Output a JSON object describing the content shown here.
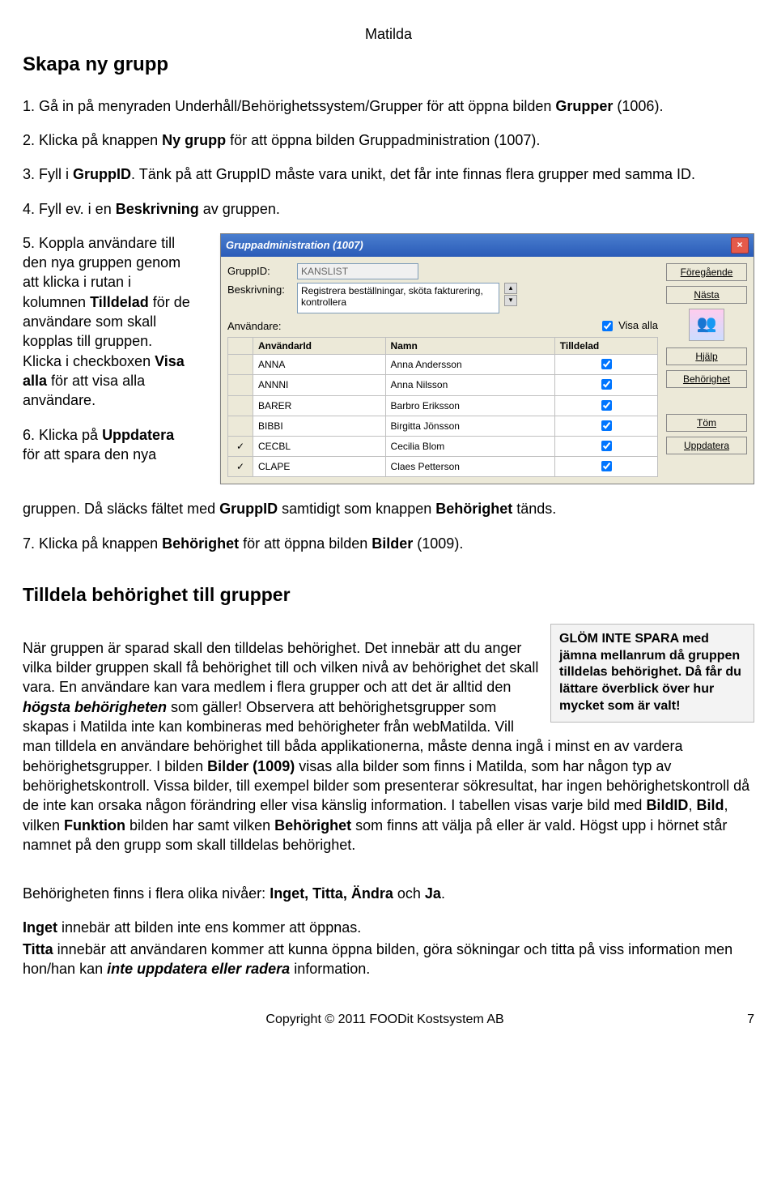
{
  "doc": {
    "header": "Matilda",
    "h1": "Skapa ny grupp",
    "step1_a": "1. Gå in på menyraden Underhåll/Behörighetssystem/Grupper för att öppna bilden ",
    "step1_b": "Grupper",
    "step1_c": " (1006).",
    "step2_a": "2. Klicka på knappen ",
    "step2_b": "Ny grupp",
    "step2_c": " för att öppna bilden Gruppadministration (1007).",
    "step3_a": "3. Fyll i ",
    "step3_b": "GruppID",
    "step3_c": ". Tänk på att GruppID måste vara unikt, det får inte finnas flera grupper med samma ID.",
    "step4_a": "4. Fyll ev. i en ",
    "step4_b": "Beskrivning",
    "step4_c": " av gruppen.",
    "step5_a": "5. Koppla användare till den nya gruppen genom att klicka i rutan i kolumnen ",
    "step5_b": "Tilldelad",
    "step5_c": " för de användare som skall kopplas till gruppen. Klicka i checkboxen ",
    "step5_d": "Visa alla",
    "step5_e": " för att visa alla användare.",
    "step6_a": "6. Klicka på ",
    "step6_b": "Uppdatera",
    "step6_c": " för att spara den nya",
    "step6_d": "gruppen. Då släcks fältet med ",
    "step6_e": "GruppID",
    "step6_f": " samtidigt som knappen ",
    "step6_g": "Behörighet",
    "step6_h": " tänds.",
    "step7_a": "7. Klicka på knappen ",
    "step7_b": "Behörighet",
    "step7_c": " för att öppna bilden ",
    "step7_d": "Bilder",
    "step7_e": " (1009).",
    "h2": "Tilldela behörighet till grupper",
    "tilldela_p1_a": "När gruppen är sparad skall den tilldelas behörighet. Det innebär att du anger vilka bilder gruppen skall få behörighet till och vilken nivå av behörighet det skall vara. En användare kan vara medlem i flera grupper och att det är alltid den ",
    "tilldela_p1_b": "högsta behörigheten",
    "tilldela_p1_c": " som gäller! Observera att behörighetsgrupper som skapas i Matilda inte kan kombineras med behörigheter från webMatilda. Vill man tilldela en användare behörighet till båda applikationerna, måste denna ingå i minst en av vardera behörighetsgrupper. I bilden ",
    "tilldela_p1_d": "Bilder (1009)",
    "tilldela_p1_e": " visas alla bilder som finns i Matilda, som har någon typ av behörighetskontroll. Vissa bilder, till exempel bilder som presenterar sökresultat, har ingen behörighetskontroll då de inte kan orsaka någon förändring eller visa känslig information. I tabellen visas varje bild med ",
    "tilldela_p1_f": "BildID",
    "tilldela_p1_g": ", ",
    "tilldela_p1_h": "Bild",
    "tilldela_p1_i": ", vilken ",
    "tilldela_p1_j": "Funktion",
    "tilldela_p1_k": " bilden har samt vilken ",
    "tilldela_p1_l": "Behörighet",
    "tilldela_p1_m": " som finns att välja på eller är vald. Högst upp i hörnet står namnet på den grupp som skall tilldelas behörighet.",
    "tilldela_p2_a": "Behörigheten finns i flera olika nivåer: ",
    "tilldela_p2_b": "Inget, Titta, Ändra",
    "tilldela_p2_c": " och ",
    "tilldela_p2_d": "Ja",
    "tilldela_p2_e": ".",
    "tilldela_p3_a": "Inget",
    "tilldela_p3_b": " innebär att bilden inte ens kommer att öppnas.",
    "tilldela_p4_a": "Titta",
    "tilldela_p4_b": " innebär att användaren kommer att kunna öppna bilden, göra sökningar och titta på viss information men hon/han kan ",
    "tilldela_p4_c": "inte uppdatera eller radera",
    "tilldela_p4_d": " information.",
    "callout_a": "GLÖM INTE SPARA med jämna mellanrum då gruppen tilldelas behörighet. ",
    "callout_b": "Då får du lättare överblick över hur mycket som är valt!",
    "footer_copy": "Copyright © 2011 FOODit Kostsystem AB",
    "footer_page": "7"
  },
  "dialog": {
    "title": "Gruppadministration (1007)",
    "lbl_gruppid": "GruppID:",
    "val_gruppid": "KANSLIST",
    "lbl_beskr": "Beskrivning:",
    "val_beskr": "Registrera beställningar, sköta fakturering, kontrollera",
    "lbl_anv": "Användare:",
    "lbl_visa": "Visa alla",
    "btn_prev": "Föregående",
    "btn_next": "Nästa",
    "btn_help": "Hjälp",
    "btn_behor": "Behörighet",
    "btn_tom": "Töm",
    "btn_upd": "Uppdatera",
    "th_user": "AnvändarId",
    "th_name": "Namn",
    "th_till": "Tilldelad",
    "rows": [
      {
        "id": "ANNA",
        "name": "Anna Andersson",
        "till": true,
        "sel": false
      },
      {
        "id": "ANNNI",
        "name": "Anna Nilsson",
        "till": true,
        "sel": false
      },
      {
        "id": "BARER",
        "name": "Barbro Eriksson",
        "till": true,
        "sel": false
      },
      {
        "id": "BIBBI",
        "name": "Birgitta Jönsson",
        "till": true,
        "sel": false
      },
      {
        "id": "CECBL",
        "name": "Cecilia Blom",
        "till": true,
        "sel": true
      },
      {
        "id": "CLAPE",
        "name": "Claes Petterson",
        "till": true,
        "sel": true
      }
    ]
  }
}
